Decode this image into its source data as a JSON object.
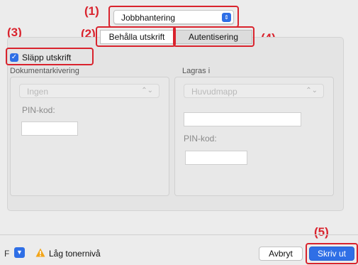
{
  "callouts": [
    "(1)",
    "(2)",
    "(3)",
    "(4)",
    "(5)"
  ],
  "job_handling_popup": {
    "value": "Jobbhantering"
  },
  "tabs": [
    {
      "label": "Behålla utskrift",
      "selected": true
    },
    {
      "label": "Autentisering",
      "selected": false
    }
  ],
  "release_print_checkbox": {
    "label": "Släpp utskrift",
    "checked": true
  },
  "document_filing": {
    "title": "Dokumentarkivering",
    "popup_value": "Ingen",
    "pin_label": "PIN-kod:",
    "pin_value": ""
  },
  "store_in": {
    "title": "Lagras i",
    "popup_value": "Huvudmapp",
    "folder_field_value": "",
    "pin_label": "PIN-kod:",
    "pin_value": ""
  },
  "footer": {
    "pdf_partial_label": "F",
    "warning_text": "Låg tonernivå",
    "cancel_label": "Avbryt",
    "print_label": "Skriv ut"
  },
  "colors": {
    "accent": "#2f6fe6",
    "callout": "#d9232d",
    "warning": "#f2a51a"
  },
  "icons": {
    "stepper": "updown-chevron-icon",
    "checkbox": "checkmark-icon",
    "warning": "warning-triangle-icon",
    "pdf_menu": "chevron-down-icon"
  }
}
